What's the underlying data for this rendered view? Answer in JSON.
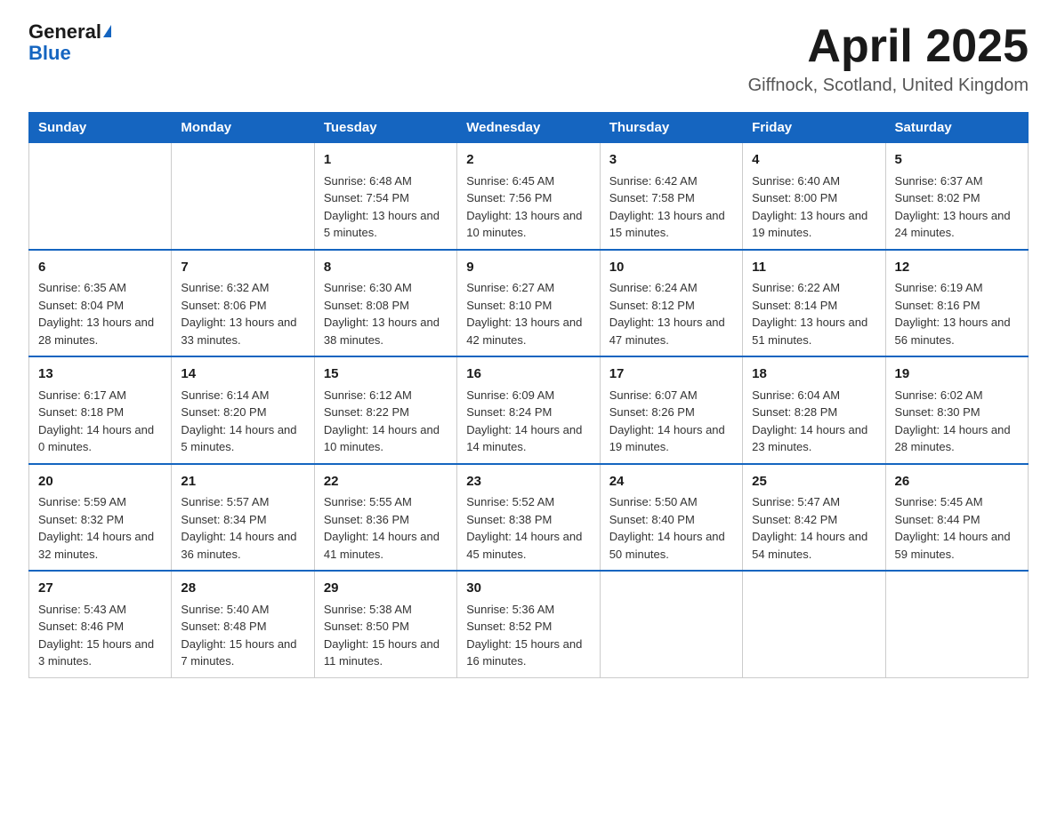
{
  "header": {
    "logo_general": "General",
    "logo_blue": "Blue",
    "title": "April 2025",
    "location": "Giffnock, Scotland, United Kingdom"
  },
  "days_of_week": [
    "Sunday",
    "Monday",
    "Tuesday",
    "Wednesday",
    "Thursday",
    "Friday",
    "Saturday"
  ],
  "weeks": [
    [
      {
        "day": "",
        "info": ""
      },
      {
        "day": "",
        "info": ""
      },
      {
        "day": "1",
        "sunrise": "6:48 AM",
        "sunset": "7:54 PM",
        "daylight": "13 hours and 5 minutes."
      },
      {
        "day": "2",
        "sunrise": "6:45 AM",
        "sunset": "7:56 PM",
        "daylight": "13 hours and 10 minutes."
      },
      {
        "day": "3",
        "sunrise": "6:42 AM",
        "sunset": "7:58 PM",
        "daylight": "13 hours and 15 minutes."
      },
      {
        "day": "4",
        "sunrise": "6:40 AM",
        "sunset": "8:00 PM",
        "daylight": "13 hours and 19 minutes."
      },
      {
        "day": "5",
        "sunrise": "6:37 AM",
        "sunset": "8:02 PM",
        "daylight": "13 hours and 24 minutes."
      }
    ],
    [
      {
        "day": "6",
        "sunrise": "6:35 AM",
        "sunset": "8:04 PM",
        "daylight": "13 hours and 28 minutes."
      },
      {
        "day": "7",
        "sunrise": "6:32 AM",
        "sunset": "8:06 PM",
        "daylight": "13 hours and 33 minutes."
      },
      {
        "day": "8",
        "sunrise": "6:30 AM",
        "sunset": "8:08 PM",
        "daylight": "13 hours and 38 minutes."
      },
      {
        "day": "9",
        "sunrise": "6:27 AM",
        "sunset": "8:10 PM",
        "daylight": "13 hours and 42 minutes."
      },
      {
        "day": "10",
        "sunrise": "6:24 AM",
        "sunset": "8:12 PM",
        "daylight": "13 hours and 47 minutes."
      },
      {
        "day": "11",
        "sunrise": "6:22 AM",
        "sunset": "8:14 PM",
        "daylight": "13 hours and 51 minutes."
      },
      {
        "day": "12",
        "sunrise": "6:19 AM",
        "sunset": "8:16 PM",
        "daylight": "13 hours and 56 minutes."
      }
    ],
    [
      {
        "day": "13",
        "sunrise": "6:17 AM",
        "sunset": "8:18 PM",
        "daylight": "14 hours and 0 minutes."
      },
      {
        "day": "14",
        "sunrise": "6:14 AM",
        "sunset": "8:20 PM",
        "daylight": "14 hours and 5 minutes."
      },
      {
        "day": "15",
        "sunrise": "6:12 AM",
        "sunset": "8:22 PM",
        "daylight": "14 hours and 10 minutes."
      },
      {
        "day": "16",
        "sunrise": "6:09 AM",
        "sunset": "8:24 PM",
        "daylight": "14 hours and 14 minutes."
      },
      {
        "day": "17",
        "sunrise": "6:07 AM",
        "sunset": "8:26 PM",
        "daylight": "14 hours and 19 minutes."
      },
      {
        "day": "18",
        "sunrise": "6:04 AM",
        "sunset": "8:28 PM",
        "daylight": "14 hours and 23 minutes."
      },
      {
        "day": "19",
        "sunrise": "6:02 AM",
        "sunset": "8:30 PM",
        "daylight": "14 hours and 28 minutes."
      }
    ],
    [
      {
        "day": "20",
        "sunrise": "5:59 AM",
        "sunset": "8:32 PM",
        "daylight": "14 hours and 32 minutes."
      },
      {
        "day": "21",
        "sunrise": "5:57 AM",
        "sunset": "8:34 PM",
        "daylight": "14 hours and 36 minutes."
      },
      {
        "day": "22",
        "sunrise": "5:55 AM",
        "sunset": "8:36 PM",
        "daylight": "14 hours and 41 minutes."
      },
      {
        "day": "23",
        "sunrise": "5:52 AM",
        "sunset": "8:38 PM",
        "daylight": "14 hours and 45 minutes."
      },
      {
        "day": "24",
        "sunrise": "5:50 AM",
        "sunset": "8:40 PM",
        "daylight": "14 hours and 50 minutes."
      },
      {
        "day": "25",
        "sunrise": "5:47 AM",
        "sunset": "8:42 PM",
        "daylight": "14 hours and 54 minutes."
      },
      {
        "day": "26",
        "sunrise": "5:45 AM",
        "sunset": "8:44 PM",
        "daylight": "14 hours and 59 minutes."
      }
    ],
    [
      {
        "day": "27",
        "sunrise": "5:43 AM",
        "sunset": "8:46 PM",
        "daylight": "15 hours and 3 minutes."
      },
      {
        "day": "28",
        "sunrise": "5:40 AM",
        "sunset": "8:48 PM",
        "daylight": "15 hours and 7 minutes."
      },
      {
        "day": "29",
        "sunrise": "5:38 AM",
        "sunset": "8:50 PM",
        "daylight": "15 hours and 11 minutes."
      },
      {
        "day": "30",
        "sunrise": "5:36 AM",
        "sunset": "8:52 PM",
        "daylight": "15 hours and 16 minutes."
      },
      {
        "day": "",
        "info": ""
      },
      {
        "day": "",
        "info": ""
      },
      {
        "day": "",
        "info": ""
      }
    ]
  ]
}
